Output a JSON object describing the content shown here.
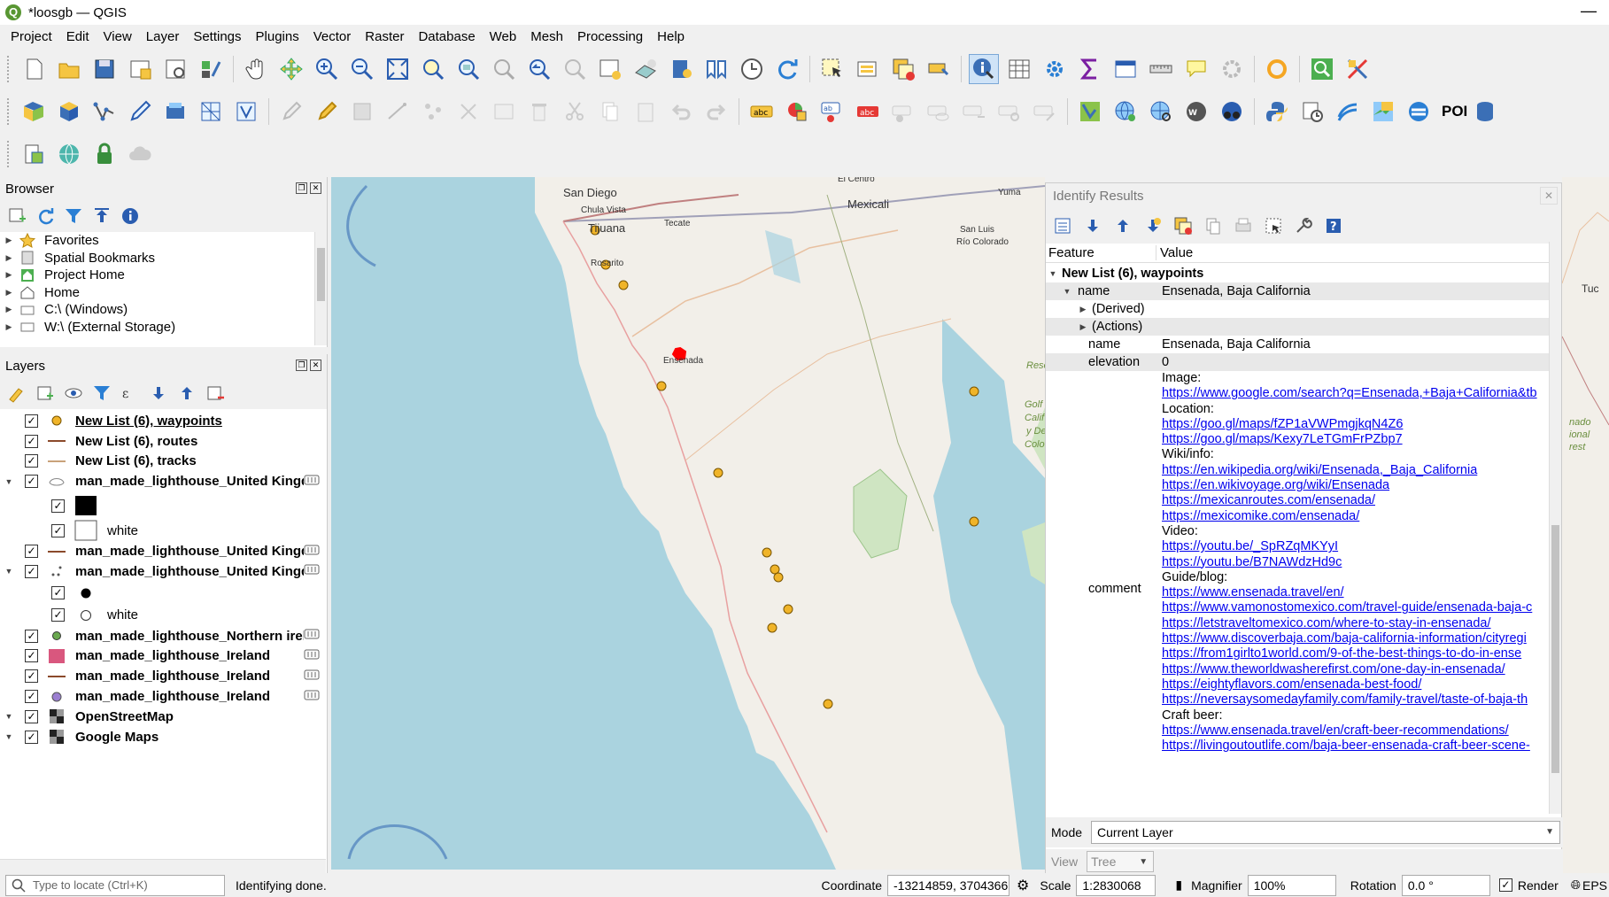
{
  "window": {
    "title": "*loosgb — QGIS",
    "logo_letter": "Q",
    "minimize": "—"
  },
  "menu": [
    "Project",
    "Edit",
    "View",
    "Layer",
    "Settings",
    "Plugins",
    "Vector",
    "Raster",
    "Database",
    "Web",
    "Mesh",
    "Processing",
    "Help"
  ],
  "toolbar": {
    "poi_label": "POI"
  },
  "browser": {
    "title": "Browser",
    "items": [
      {
        "label": "Favorites",
        "icon": "star-icon",
        "expanded": false
      },
      {
        "label": "Spatial Bookmarks",
        "icon": "bookmark-icon",
        "expanded": false
      },
      {
        "label": "Project Home",
        "icon": "project-home-icon",
        "expanded": false
      },
      {
        "label": "Home",
        "icon": "home-icon",
        "expanded": false
      },
      {
        "label": "C:\\ (Windows)",
        "icon": "drive-icon",
        "expanded": false
      },
      {
        "label": "W:\\ (External Storage)",
        "icon": "drive-icon",
        "expanded": false
      }
    ]
  },
  "layers": {
    "title": "Layers",
    "items": [
      {
        "label": "New List (6), waypoints",
        "symbol": "point-orange",
        "checked": true,
        "underline": true
      },
      {
        "label": "New List (6), routes",
        "symbol": "line-brown",
        "checked": true
      },
      {
        "label": "New List (6), tracks",
        "symbol": "line-tan",
        "checked": true
      },
      {
        "label": "man_made_lighthouse_United Kingd",
        "symbol": "polygon",
        "checked": true,
        "expander": true
      },
      {
        "label": "",
        "symbol": "square-black",
        "checked": true,
        "child": true
      },
      {
        "label": "white",
        "symbol": "square-white",
        "checked": true,
        "child": true
      },
      {
        "label": "man_made_lighthouse_United Kingd",
        "symbol": "line-brown",
        "checked": true
      },
      {
        "label": "man_made_lighthouse_United Kingd",
        "symbol": "points",
        "checked": true,
        "expander": true
      },
      {
        "label": "",
        "symbol": "dot-black",
        "checked": true,
        "child": true
      },
      {
        "label": "white",
        "symbol": "dot-white",
        "checked": true,
        "child": true
      },
      {
        "label": "man_made_lighthouse_Northern irel",
        "symbol": "point-green",
        "checked": true
      },
      {
        "label": "man_made_lighthouse_Ireland",
        "symbol": "square-pink",
        "checked": true
      },
      {
        "label": "man_made_lighthouse_Ireland",
        "symbol": "line-brown",
        "checked": true
      },
      {
        "label": "man_made_lighthouse_Ireland",
        "symbol": "point-purple",
        "checked": true
      },
      {
        "label": "OpenStreetMap",
        "symbol": "raster",
        "checked": true,
        "expander": true
      },
      {
        "label": "Google Maps",
        "symbol": "raster",
        "checked": true,
        "expander": true
      }
    ]
  },
  "map_labels": {
    "san_diego": "San Diego",
    "chula_vista": "Chula Vista",
    "tijuana": "Tijuana",
    "tecate": "Tecate",
    "mexicali": "Mexicali",
    "yuma": "Yuma",
    "san_luis": "San Luis",
    "rio_colorado": "Río Colorado",
    "rosarito": "Rosarito",
    "ensenada": "Ensenada",
    "el_centro": "El Centro",
    "tuc": "Tuc",
    "reserva": "Rese",
    "golfo": "Golf",
    "calif": "Calif",
    "y_de": "y De",
    "colo": "Colo",
    "nacional1": "nado",
    "nacional2": "ional",
    "nacional3": "rest"
  },
  "identify": {
    "title": "Identify Results",
    "col_feature": "Feature",
    "col_value": "Value",
    "layer_node": "New List (6), waypoints",
    "name_node": {
      "field": "name",
      "value": "Ensenada, Baja California"
    },
    "derived": "(Derived)",
    "actions": "(Actions)",
    "attr_name": {
      "field": "name",
      "value": "Ensenada, Baja California"
    },
    "attr_elevation": {
      "field": "elevation",
      "value": "0"
    },
    "comment_field": "comment",
    "comment_lines": [
      {
        "text": "Image:",
        "link": false
      },
      {
        "text": "https://www.google.com/search?q=Ensenada,+Baja+California&tb",
        "link": true
      },
      {
        "text": "Location:",
        "link": false
      },
      {
        "text": "https://goo.gl/maps/fZP1aVWPmgjkqN4Z6",
        "link": true
      },
      {
        "text": "https://goo.gl/maps/Kexy7LeTGmFrPZbp7",
        "link": true
      },
      {
        "text": "Wiki/info:",
        "link": false
      },
      {
        "text": "https://en.wikipedia.org/wiki/Ensenada,_Baja_California",
        "link": true
      },
      {
        "text": "https://en.wikivoyage.org/wiki/Ensenada",
        "link": true
      },
      {
        "text": "https://mexicanroutes.com/ensenada/",
        "link": true
      },
      {
        "text": "https://mexicomike.com/ensenada/",
        "link": true
      },
      {
        "text": "Video:",
        "link": false
      },
      {
        "text": "https://youtu.be/_SpRZqMKYyI",
        "link": true
      },
      {
        "text": "https://youtu.be/B7NAWdzHd9c",
        "link": true
      },
      {
        "text": "Guide/blog:",
        "link": false
      },
      {
        "text": "https://www.ensenada.travel/en/",
        "link": true
      },
      {
        "text": "https://www.vamonostomexico.com/travel-guide/ensenada-baja-c",
        "link": true
      },
      {
        "text": "https://letstraveltomexico.com/where-to-stay-in-ensenada/",
        "link": true
      },
      {
        "text": "https://www.discoverbaja.com/baja-california-information/cityregi",
        "link": true
      },
      {
        "text": "https://from1girlto1world.com/9-of-the-best-things-to-do-in-ense",
        "link": true
      },
      {
        "text": "https://www.theworldwasherefirst.com/one-day-in-ensenada/",
        "link": true
      },
      {
        "text": "https://eightyflavors.com/ensenada-best-food/",
        "link": true
      },
      {
        "text": "https://neversaysomedayfamily.com/family-travel/taste-of-baja-th",
        "link": true
      },
      {
        "text": "Craft beer:",
        "link": false
      },
      {
        "text": "https://www.ensenada.travel/en/craft-beer-recommendations/",
        "link": true
      },
      {
        "text": "https://livingoutoutlife.com/baja-beer-ensenada-craft-beer-scene-",
        "link": true
      }
    ],
    "mode_label": "Mode",
    "mode_value": "Current Layer",
    "view_label": "View",
    "view_value": "Tree"
  },
  "status": {
    "locate_placeholder": "Type to locate (Ctrl+K)",
    "message": "Identifying done.",
    "coordinate_label": "Coordinate",
    "coordinate_value": "-13214859, 3704366",
    "scale_label": "Scale",
    "scale_value": "1:2830068",
    "magnifier_label": "Magnifier",
    "magnifier_value": "100%",
    "rotation_label": "Rotation",
    "rotation_value": "0.0 °",
    "render_label": "Render",
    "crs_label": "EPS"
  },
  "colors": {
    "water": "#aad3df",
    "land": "#f2efe9",
    "link": "#0000ee",
    "waypoint": "#f0b429",
    "selected": "#ff0000"
  }
}
